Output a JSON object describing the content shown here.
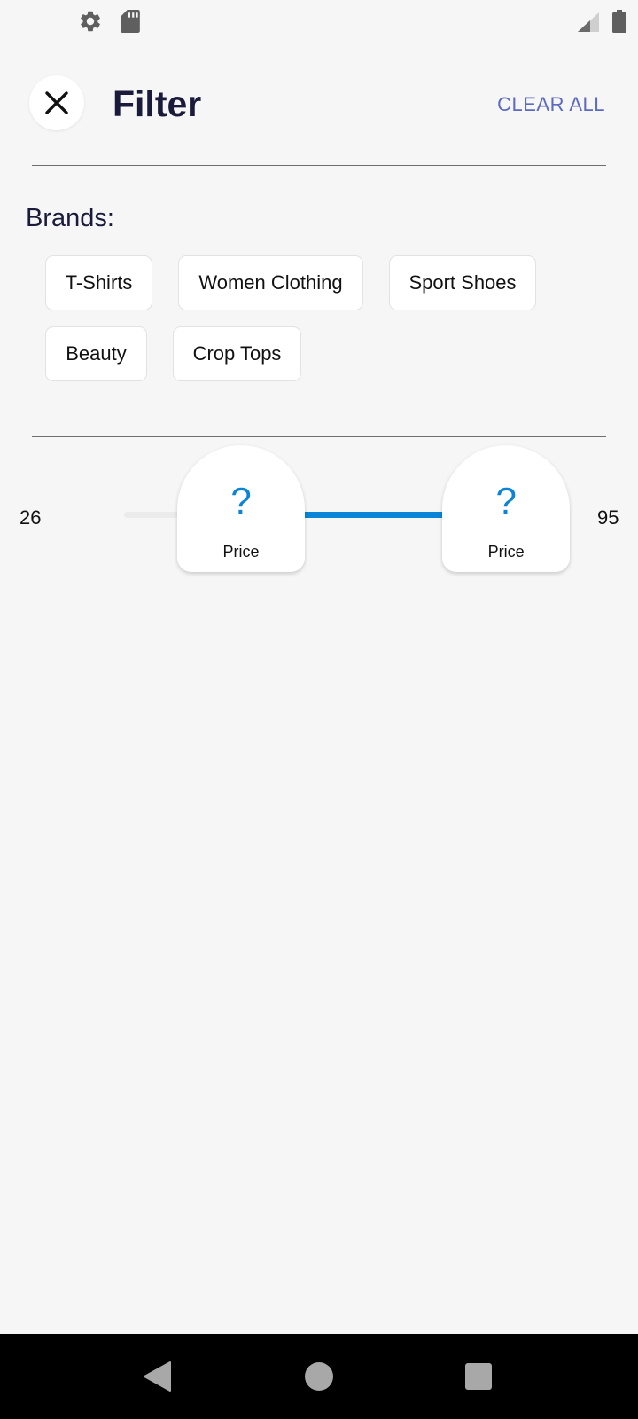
{
  "status_bar": {
    "icons": [
      "gear-icon",
      "sd-card-icon",
      "signal-icon",
      "battery-icon"
    ]
  },
  "header": {
    "close_icon": "close-icon",
    "title": "Filter",
    "clear_all": "CLEAR ALL"
  },
  "brands": {
    "label": "Brands:",
    "chips": [
      "T-Shirts",
      "Women Clothing",
      "Sport Shoes",
      "Beauty",
      "Crop Tops"
    ]
  },
  "price": {
    "min": "26",
    "max": "95",
    "thumbs": [
      {
        "symbol": "?",
        "label": "Price",
        "position": 0.3
      },
      {
        "symbol": "?",
        "label": "Price",
        "position": 0.98
      }
    ]
  },
  "nav_bar": {
    "icons": [
      "back-icon",
      "home-icon",
      "recent-apps-icon"
    ]
  },
  "colors": {
    "accent": "#0a84d6",
    "clear_all": "#5c6bc0",
    "title": "#1a1b3a",
    "background": "#f6f6f6"
  }
}
